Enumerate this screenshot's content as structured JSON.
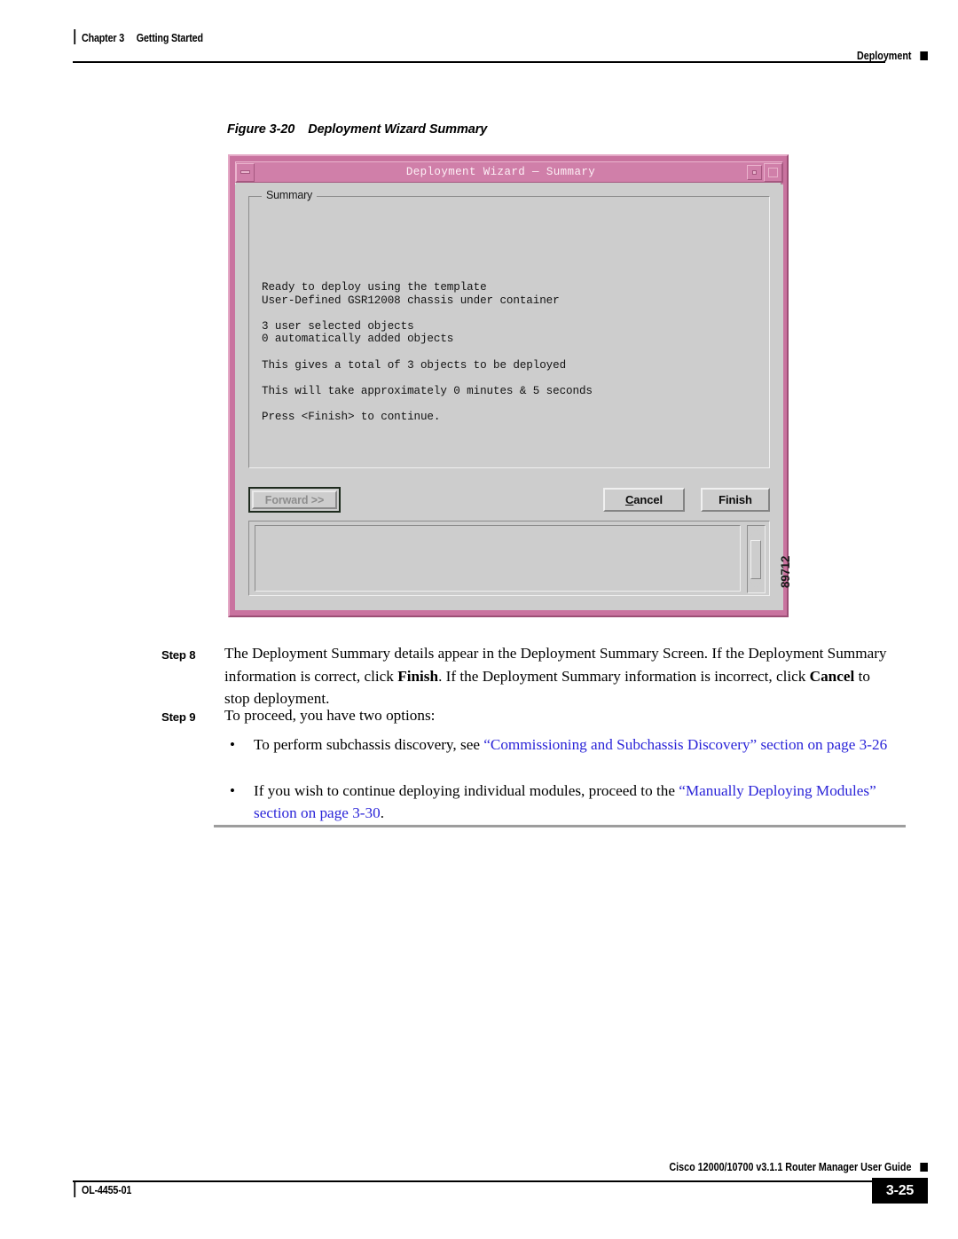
{
  "header": {
    "chapter": "Chapter 3",
    "chapter_title": "Getting Started",
    "section": "Deployment"
  },
  "figure": {
    "number": "Figure 3-20",
    "title": "Deployment Wizard Summary",
    "id_label": "89712"
  },
  "dialog": {
    "title": "Deployment Wizard — Summary",
    "titlebar_color": "#d07fa9",
    "frame_color": "#c9739f",
    "face_color": "#cdcdcd",
    "minimize_icon": "minimize-icon",
    "restore_icon": "restore-icon",
    "maximize_icon": "maximize-icon",
    "group_label": "Summary",
    "summary_text": "Ready to deploy using the template\nUser-Defined GSR12008 chassis under container\n\n3 user selected objects\n0 automatically added objects\n\nThis gives a total of 3 objects to be deployed\n\nThis will take approximately 0 minutes & 5 seconds\n\nPress <Finish> to continue.",
    "buttons": {
      "forward": "Forward >>",
      "forward_disabled": true,
      "cancel": "Cancel",
      "cancel_mnemonic": "C",
      "finish": "Finish"
    },
    "log_panel_text": "",
    "scrollbar": {
      "up_icon": "scroll-up-arrow-icon",
      "down_icon": "scroll-down-arrow-icon"
    }
  },
  "steps": [
    {
      "label": "Step 8",
      "text_parts": [
        {
          "t": "The Deployment Summary details appear in the Deployment Summary Screen. If the Deployment Summary information is correct, click ",
          "style": "normal"
        },
        {
          "t": "Finish",
          "style": "bold"
        },
        {
          "t": ". If the Deployment Summary information is incorrect, click ",
          "style": "normal"
        },
        {
          "t": "Cancel",
          "style": "bold"
        },
        {
          "t": " to stop deployment.",
          "style": "normal"
        }
      ]
    },
    {
      "label": "Step 9",
      "text_parts": [
        {
          "t": "To proceed, you have two options:",
          "style": "normal"
        }
      ]
    }
  ],
  "bullets": [
    {
      "marker": "•",
      "parts": [
        {
          "t": "To perform subchassis discovery, see ",
          "style": "normal"
        },
        {
          "t": "“Commissioning and Subchassis Discovery” section on page 3-26",
          "style": "xref"
        }
      ]
    },
    {
      "marker": "•",
      "parts": [
        {
          "t": "If you wish to continue deploying individual modules, proceed to the ",
          "style": "normal"
        },
        {
          "t": "“Manually Deploying Modules” section on page 3-30",
          "style": "xref"
        },
        {
          "t": ".",
          "style": "normal"
        }
      ]
    }
  ],
  "footer": {
    "guide_title": "Cisco 12000/10700 v3.1.1 Router Manager User Guide",
    "doc_number": "OL-4455-01",
    "page_number": "3-25"
  }
}
